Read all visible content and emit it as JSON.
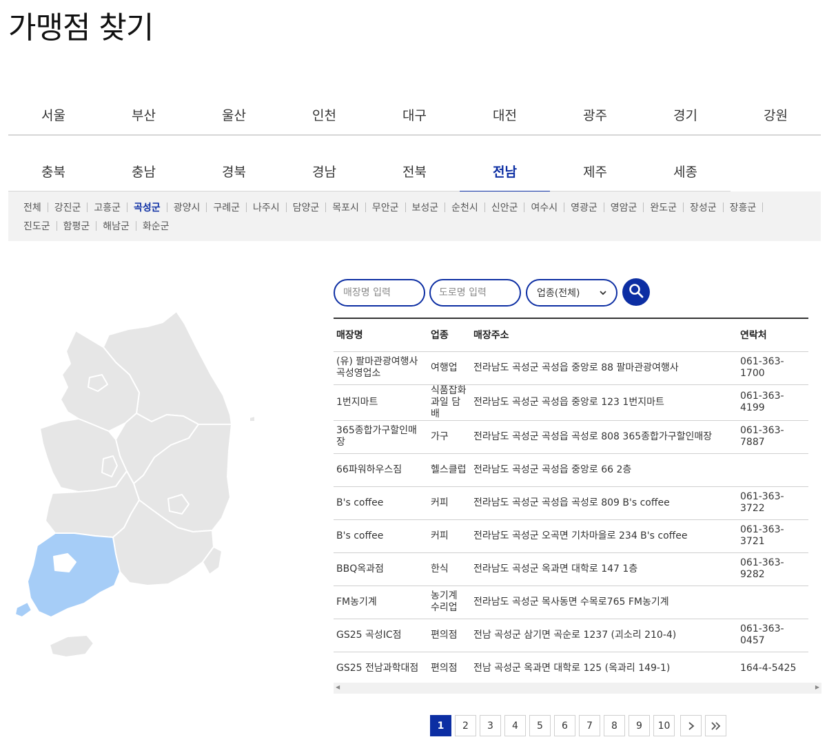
{
  "page_title": "가맹점 찾기",
  "regions_row1": [
    "서울",
    "부산",
    "울산",
    "인천",
    "대구",
    "대전",
    "광주",
    "경기",
    "강원"
  ],
  "regions_row2": [
    "충북",
    "충남",
    "경북",
    "경남",
    "전북",
    "전남",
    "제주",
    "세종"
  ],
  "active_region": "전남",
  "districts": [
    "전체",
    "강진군",
    "고흥군",
    "곡성군",
    "광양시",
    "구례군",
    "나주시",
    "담양군",
    "목포시",
    "무안군",
    "보성군",
    "순천시",
    "신안군",
    "여수시",
    "영광군",
    "영암군",
    "완도군",
    "장성군",
    "장흥군",
    "진도군",
    "함평군",
    "해남군",
    "화순군"
  ],
  "active_district": "곡성군",
  "search": {
    "store_placeholder": "매장명 입력",
    "road_placeholder": "도로명 입력",
    "category_selected": "업종(전체)"
  },
  "table": {
    "headers": [
      "매장명",
      "업종",
      "매장주소",
      "연락처"
    ],
    "rows": [
      [
        "(유) 팔마관광여행사곡성영업소",
        "여행업",
        "전라남도 곡성군 곡성읍 중앙로 88 팔마관광여행사",
        "061-363-1700"
      ],
      [
        "1번지마트",
        "식품잡화 과일 담배",
        "전라남도 곡성군 곡성읍 중앙로 123 1번지마트",
        "061-363-4199"
      ],
      [
        "365종합가구할인매장",
        "가구",
        "전라남도 곡성군 곡성읍 곡성로 808 365종합가구할인매장",
        "061-363-7887"
      ],
      [
        "66파워하우스짐",
        "헬스클럽",
        "전라남도 곡성군 곡성읍 중앙로 66 2층",
        ""
      ],
      [
        "B's coffee",
        "커피",
        "전라남도 곡성군 곡성읍 곡성로 809 B's coffee",
        "061-363-3722"
      ],
      [
        "B's coffee",
        "커피",
        "전라남도 곡성군 오곡면 기차마을로 234 B's coffee",
        "061-363-3721"
      ],
      [
        "BBQ옥과점",
        "한식",
        "전라남도 곡성군 옥과면 대학로 147 1층",
        "061-363-9282"
      ],
      [
        "FM농기계",
        "농기계 수리업",
        "전라남도 곡성군 목사동면 수목로765 FM농기계",
        ""
      ],
      [
        "GS25 곡성IC점",
        "편의점",
        "전남 곡성군 삼기면 곡순로 1237 (괴소리 210-4)",
        "061-363-0457"
      ],
      [
        "GS25 전남과학대점",
        "편의점",
        "전남 곡성군 옥과면 대학로 125 (옥과리 149-1)",
        "164-4-5425"
      ]
    ]
  },
  "pagination": {
    "pages": [
      "1",
      "2",
      "3",
      "4",
      "5",
      "6",
      "7",
      "8",
      "9",
      "10"
    ],
    "current": "1",
    "next_label": "›",
    "last_label": "»"
  },
  "map": {
    "highlighted_region": "전남",
    "highlight_color": "#a6cdf7",
    "base_color": "#e6e6e6"
  },
  "colors": {
    "accent": "#0c2ea3"
  }
}
